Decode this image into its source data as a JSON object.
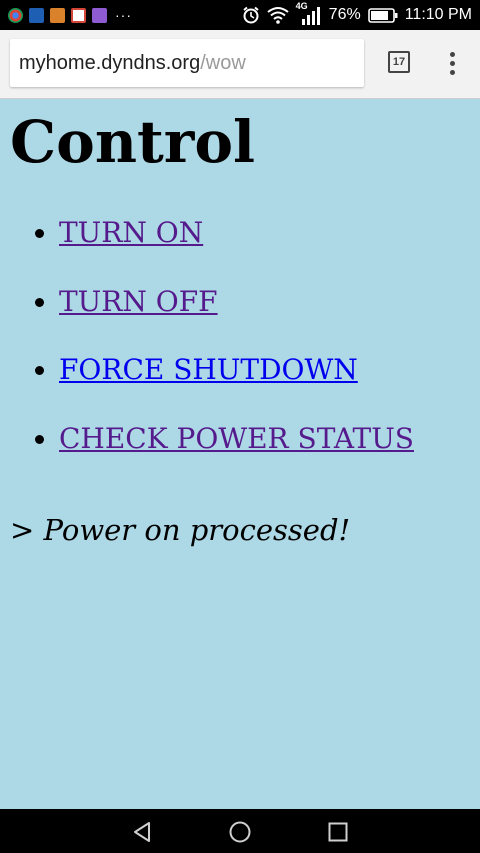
{
  "status_bar": {
    "battery_percent": "76%",
    "time": "11:10 PM",
    "network_type": "4G",
    "more_notifications": "···",
    "notification_icons": [
      "chrome-icon",
      "mail-icon",
      "app-icon",
      "gmail-icon",
      "photos-icon"
    ]
  },
  "browser": {
    "url_host": "myhome.dyndns.org",
    "url_path": "/wow",
    "tab_count": "17"
  },
  "page": {
    "heading": "Control",
    "links": [
      {
        "label": "TURN ON",
        "visited": true
      },
      {
        "label": "TURN OFF",
        "visited": true
      },
      {
        "label": "FORCE SHUTDOWN",
        "visited": false
      },
      {
        "label": "CHECK POWER STATUS",
        "visited": true
      }
    ],
    "status_message": "> Power on processed!"
  },
  "colors": {
    "page_background": "#add8e6",
    "visited_link": "#551a8b",
    "unvisited_link": "#0000ee"
  }
}
